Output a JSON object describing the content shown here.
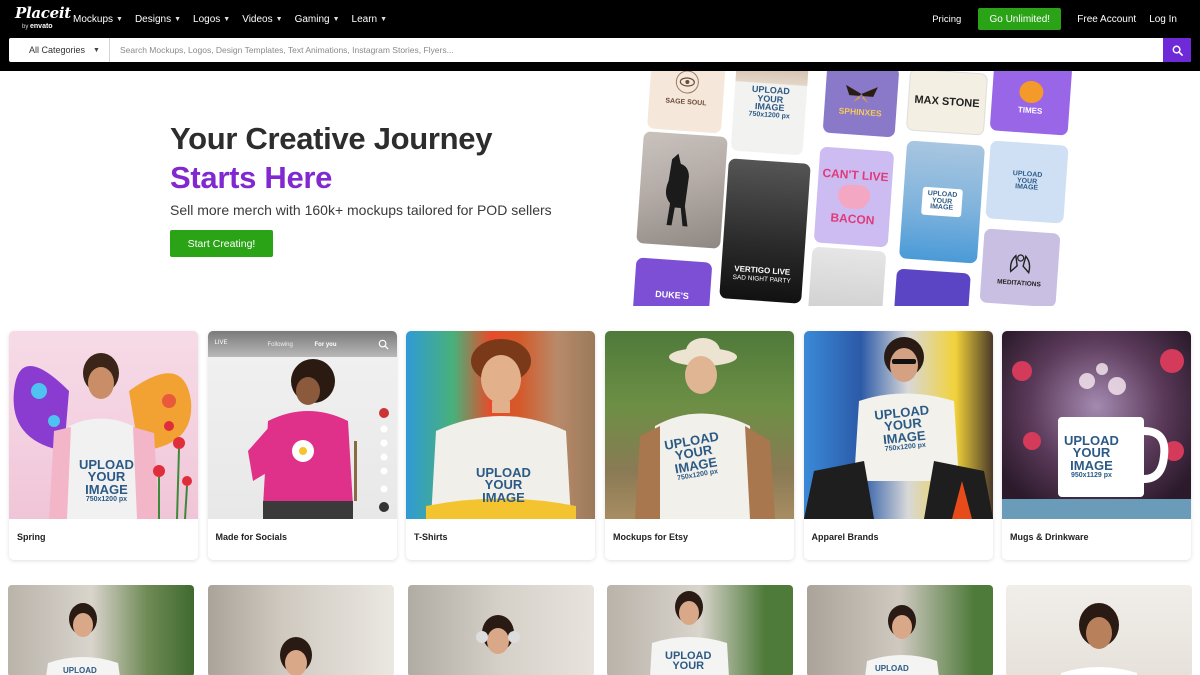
{
  "brand": {
    "logo_main": "Placeit",
    "logo_by": "by",
    "logo_envato": "envato"
  },
  "nav": {
    "items": [
      {
        "label": "Mockups"
      },
      {
        "label": "Designs"
      },
      {
        "label": "Logos"
      },
      {
        "label": "Videos"
      },
      {
        "label": "Gaming"
      },
      {
        "label": "Learn"
      }
    ],
    "pricing": "Pricing",
    "cta": "Go Unlimited!",
    "free_account": "Free Account",
    "login": "Log In"
  },
  "search": {
    "category": "All Categories",
    "placeholder": "Search Mockups, Logos, Design Templates, Text Animations, Instagram Stories, Flyers..."
  },
  "hero": {
    "title": "Your Creative Journey",
    "accent": "Starts Here",
    "subtitle": "Sell more merch with 160k+ mockups tailored for POD sellers",
    "cta": "Start Creating!"
  },
  "collage": {
    "sage_soul": "SAGE SOUL",
    "upload_line1": "UPLOAD",
    "upload_line2": "YOUR",
    "upload_line3": "IMAGE",
    "upload_dims_a": "750x1200 px",
    "sphinxes": "SPHINXES",
    "max_stone": "MAX STONE",
    "times": "TIMES",
    "cant_live": "CAN'T LIVE",
    "bacon": "BACON",
    "vertigo": "VERTIGO LIVE",
    "night_party": "SAD NIGHT PARTY",
    "dukes": "DUKE'S",
    "meditations": "MEDITATIONS"
  },
  "cards": [
    {
      "label": "Spring"
    },
    {
      "label": "Made for Socials"
    },
    {
      "label": "T-Shirts"
    },
    {
      "label": "Mockups for Etsy"
    },
    {
      "label": "Apparel Brands"
    },
    {
      "label": "Mugs & Drinkware"
    }
  ],
  "social_ui": {
    "live": "LIVE",
    "following": "Following",
    "for_you": "For you"
  },
  "upload_text": {
    "l1": "UPLOAD",
    "l2": "YOUR",
    "l3": "IMAGE",
    "dim_shirt": "750x1200 px",
    "dim_mug": "950x1129 px"
  },
  "colors": {
    "accent_purple": "#8228d0",
    "cta_green": "#2aa316",
    "search_button": "#6f2ad8",
    "nav_bg": "#000000"
  }
}
